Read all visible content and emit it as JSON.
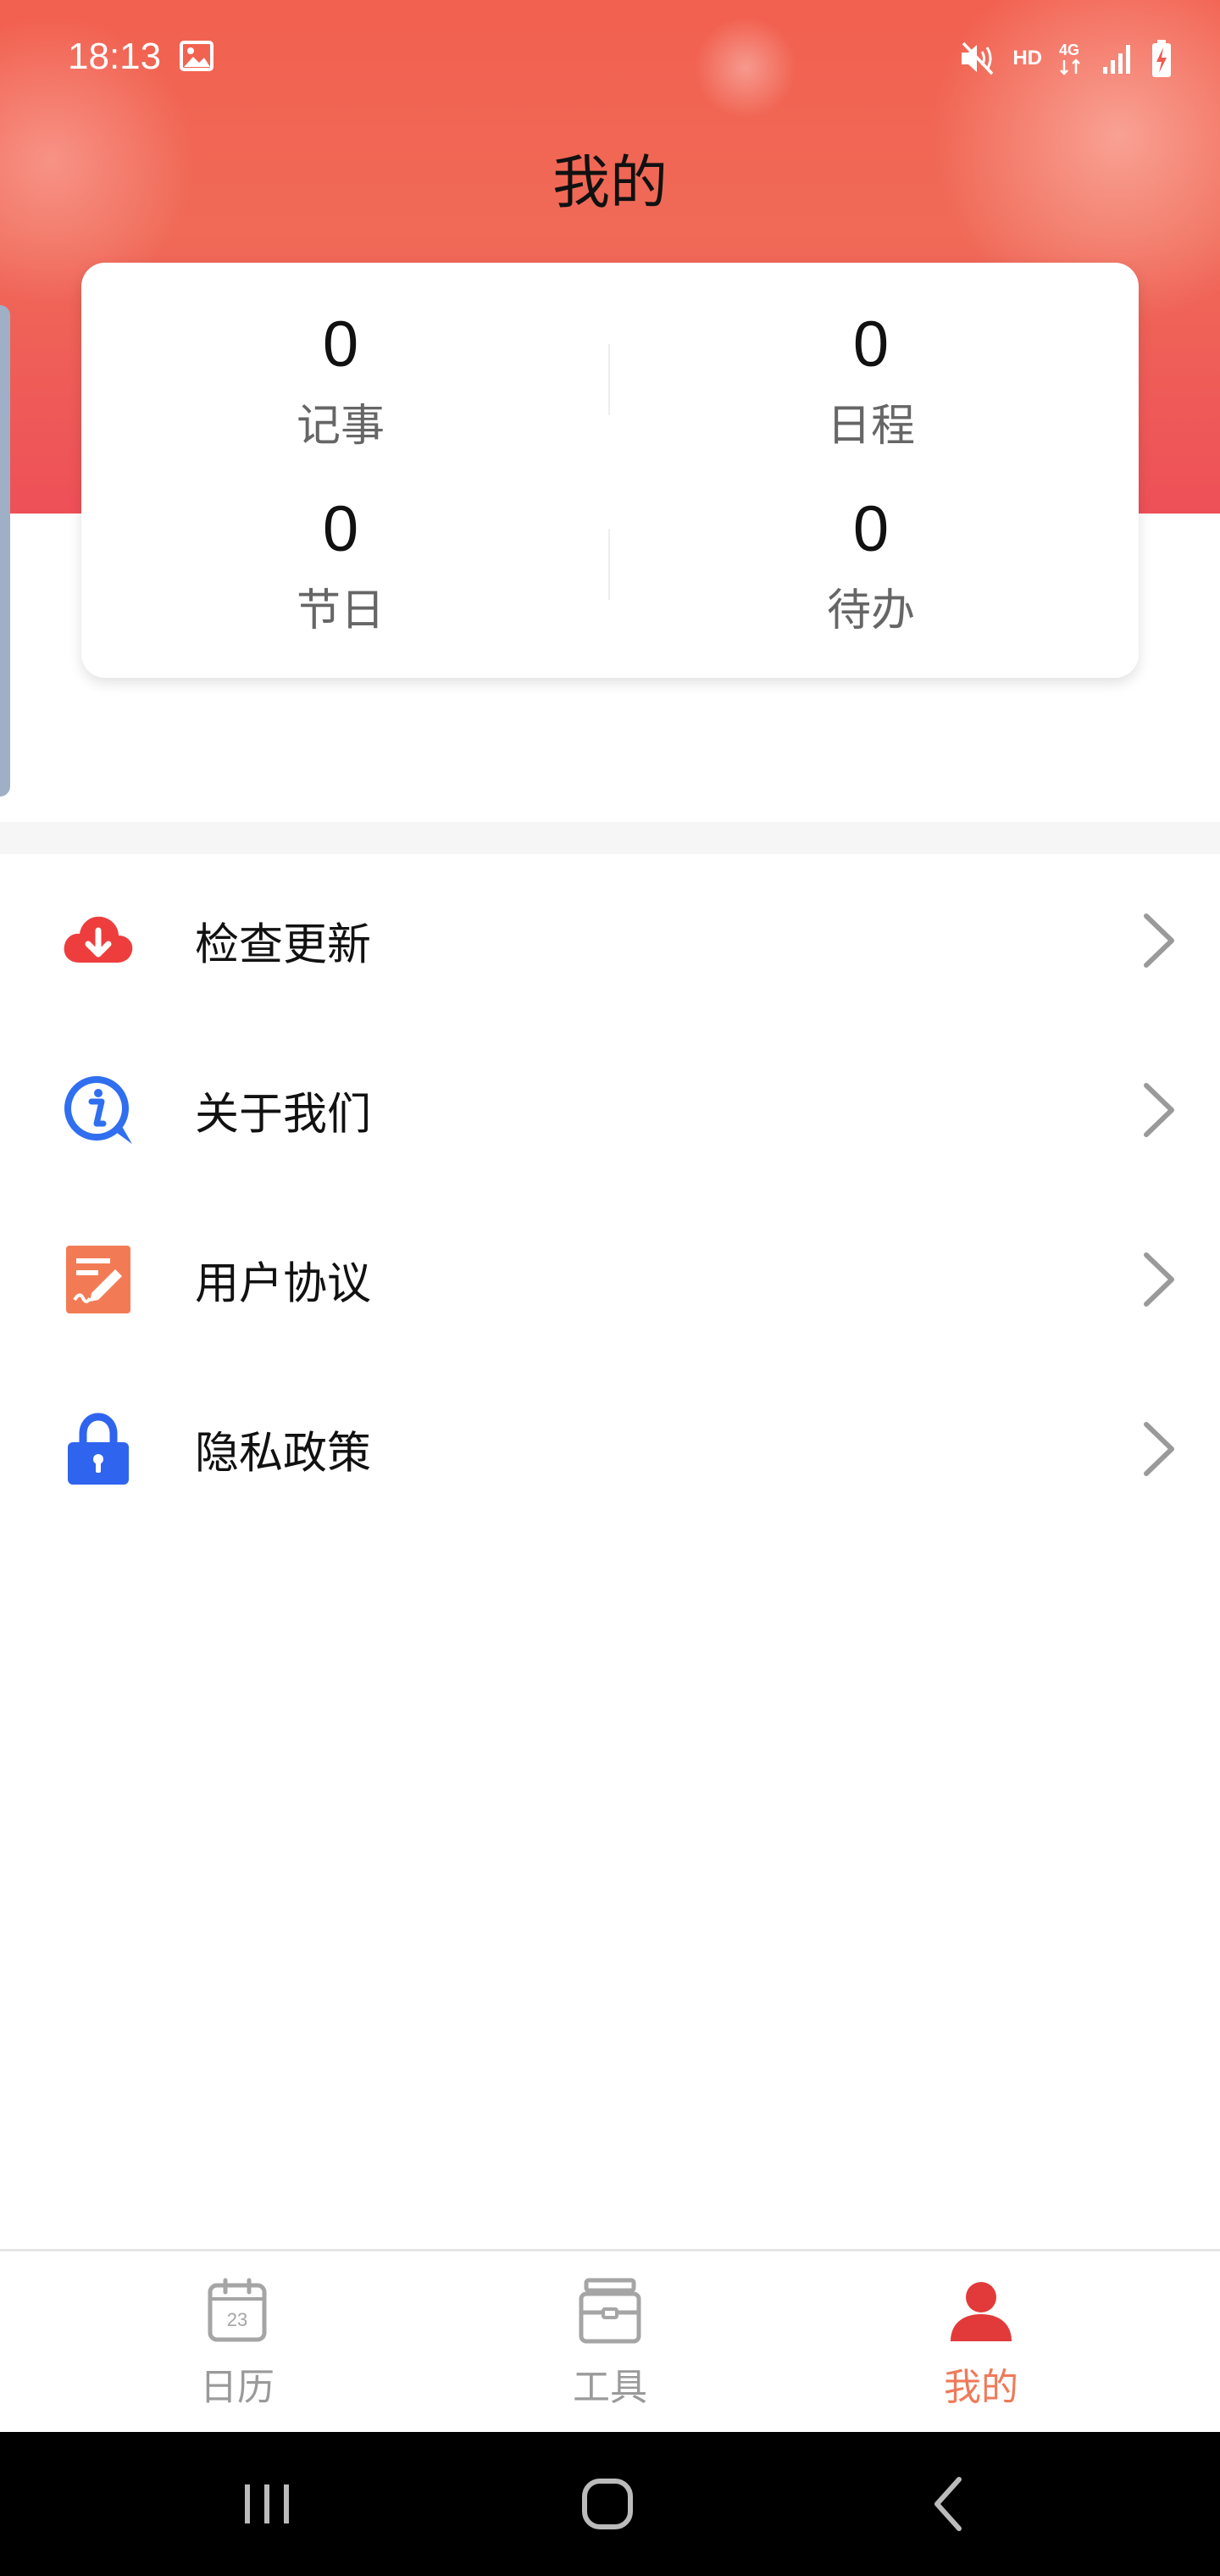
{
  "status_bar": {
    "time": "18:13",
    "network_label": "HD",
    "icons": [
      "image-icon",
      "mute-icon",
      "hd-icon",
      "4g-icon",
      "signal-icon",
      "battery-charging-icon"
    ]
  },
  "header": {
    "title": "我的",
    "accent_color": "#f05a50"
  },
  "stats": [
    {
      "value": "0",
      "label": "记事"
    },
    {
      "value": "0",
      "label": "日程"
    },
    {
      "value": "0",
      "label": "节日"
    },
    {
      "value": "0",
      "label": "待办"
    }
  ],
  "menu": [
    {
      "label": "检查更新",
      "icon": "cloud-download-icon"
    },
    {
      "label": "关于我们",
      "icon": "info-icon"
    },
    {
      "label": "用户协议",
      "icon": "document-sign-icon"
    },
    {
      "label": "隐私政策",
      "icon": "lock-icon"
    }
  ],
  "tabs": [
    {
      "label": "日历",
      "icon": "calendar-icon",
      "calendar_day": "23",
      "active": false
    },
    {
      "label": "工具",
      "icon": "toolbox-icon",
      "active": false
    },
    {
      "label": "我的",
      "icon": "user-icon",
      "active": true
    }
  ],
  "colors": {
    "tab_active": "#ef7a5a",
    "tab_inactive": "#9a9a9a"
  }
}
